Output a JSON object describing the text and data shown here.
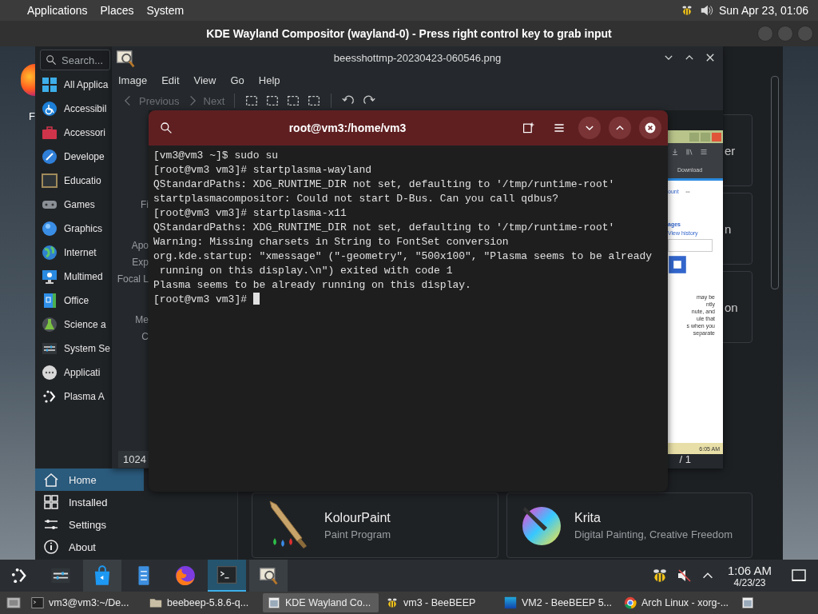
{
  "top_panel": {
    "menus": [
      {
        "label": "Applications"
      },
      {
        "label": "Places"
      },
      {
        "label": "System"
      }
    ],
    "clock": "Sun Apr 23, 01:06"
  },
  "vm_window": {
    "title": "KDE Wayland Compositor (wayland-0) - Press right control key to grab input"
  },
  "desktop": {
    "icon_label": "F"
  },
  "discover": {
    "search": {
      "placeholder": "Search..."
    },
    "categories": [
      {
        "label": "All Applica"
      },
      {
        "label": "Accessibil"
      },
      {
        "label": "Accessori"
      },
      {
        "label": "Develope"
      },
      {
        "label": "Educatio"
      },
      {
        "label": "Games"
      },
      {
        "label": "Graphics"
      },
      {
        "label": "Internet"
      },
      {
        "label": "Multimed"
      },
      {
        "label": "Office"
      },
      {
        "label": "Science a"
      },
      {
        "label": "System Se"
      },
      {
        "label": "Applicati"
      },
      {
        "label": "Plasma A"
      }
    ],
    "nav": [
      {
        "label": "Home",
        "selected": true
      },
      {
        "label": "Installed",
        "selected": false
      },
      {
        "label": "Settings",
        "selected": false
      },
      {
        "label": "About",
        "selected": false
      }
    ],
    "partial_cards": [
      "er",
      "n",
      "on"
    ],
    "apps": [
      {
        "name": "KolourPaint",
        "description": "Paint Program"
      },
      {
        "name": "Krita",
        "description": "Digital Painting, Creative Freedom"
      }
    ]
  },
  "image_viewer": {
    "title": "beesshottmp-20230423-060546.png",
    "menus": [
      "Image",
      "Edit",
      "View",
      "Go",
      "Help"
    ],
    "toolbar": [
      {
        "label": "Previous",
        "disabled": true
      },
      {
        "label": "Next",
        "disabled": true
      }
    ],
    "info_groups": [
      [
        "Fi"
      ],
      [
        "Apo",
        "Exp",
        "Focal L"
      ],
      [
        "Me",
        "C"
      ]
    ],
    "screenshot": {
      "tab": "Download",
      "link": "ount",
      "heading": "ages",
      "history": "View history",
      "paragraph": [
        "may be",
        "ntly",
        "nute, and",
        "ule that",
        "s when you",
        "separate"
      ],
      "time": "6:05 AM"
    },
    "status": {
      "size": "1024",
      "page": "/ 1"
    }
  },
  "terminal": {
    "title": "root@vm3:/home/vm3",
    "lines": [
      "[vm3@vm3 ~]$ sudo su",
      "[root@vm3 vm3]# startplasma-wayland",
      "QStandardPaths: XDG_RUNTIME_DIR not set, defaulting to '/tmp/runtime-root'",
      "startplasmacompositor: Could not start D-Bus. Can you call qdbus?",
      "[root@vm3 vm3]# startplasma-x11",
      "QStandardPaths: XDG_RUNTIME_DIR not set, defaulting to '/tmp/runtime-root'",
      "Warning: Missing charsets in String to FontSet conversion",
      "org.kde.startup: \"xmessage\" (\"-geometry\", \"500x100\", \"Plasma seems to be already",
      " running on this display.\\n\") exited with code 1",
      "Plasma seems to be already running on this display.",
      "[root@vm3 vm3]# "
    ]
  },
  "kde_panel": {
    "tasks": [
      {
        "selected": false,
        "open": false
      },
      {
        "selected": false,
        "open": false
      },
      {
        "selected": false,
        "open": true
      },
      {
        "selected": false,
        "open": false
      },
      {
        "selected": false,
        "open": false
      },
      {
        "selected": true,
        "open": true
      },
      {
        "selected": false,
        "open": true
      }
    ],
    "clock": "1:06 AM",
    "date": "4/23/23"
  },
  "bottom_panel": {
    "windows": [
      {
        "label": "vm3@vm3:~/De...",
        "selected": false
      },
      {
        "label": "beebeep-5.8.6-q...",
        "selected": false
      },
      {
        "label": "KDE Wayland Co...",
        "selected": true
      },
      {
        "label": "vm3 - BeeBEEP",
        "selected": false
      },
      {
        "label": "VM2 - BeeBEEP 5...",
        "selected": false
      },
      {
        "label": "Arch Linux - xorg-...",
        "selected": false
      }
    ]
  }
}
